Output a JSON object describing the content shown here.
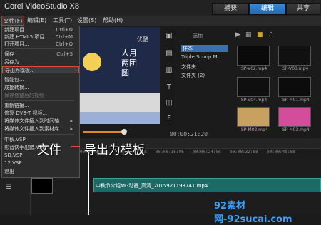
{
  "app": {
    "title": "Corel VideoStudio X8"
  },
  "mode_tabs": {
    "capture": "捕获",
    "edit": "编辑",
    "share": "共享"
  },
  "menubar": {
    "file": "文件(F)",
    "edit": "编辑(E)",
    "tools": "工具(T)",
    "settings": "设置(S)",
    "help": "帮助(H)"
  },
  "file_menu": {
    "items": [
      {
        "label": "新建项目",
        "shortcut": "Ctrl+N"
      },
      {
        "label": "新建 HTML5 项目",
        "shortcut": "Ctrl+M"
      },
      {
        "label": "打开项目...",
        "shortcut": "Ctrl+O"
      },
      {
        "label": "保存",
        "shortcut": "Ctrl+S"
      },
      {
        "label": "另存为...",
        "shortcut": ""
      },
      {
        "label": "导出为模板...",
        "shortcut": ""
      },
      {
        "label": "智能包...",
        "shortcut": ""
      },
      {
        "label": "成批转换...",
        "shortcut": ""
      },
      {
        "label": "保存修整后的视频",
        "shortcut": ""
      },
      {
        "label": "重新链接...",
        "shortcut": ""
      },
      {
        "label": "修复 DVB-T 视频...",
        "shortcut": ""
      },
      {
        "label": "将媒体文件插入到时间轴",
        "shortcut": "▸"
      },
      {
        "label": "将媒体文件插入到素材库",
        "shortcut": "▸"
      },
      {
        "label": "中秋.VSP",
        "shortcut": ""
      },
      {
        "label": "影音快手出錯.VSP",
        "shortcut": ""
      },
      {
        "label": "SD.VSP",
        "shortcut": ""
      },
      {
        "label": "12.VSP",
        "shortcut": ""
      },
      {
        "label": "退出",
        "shortcut": ""
      }
    ]
  },
  "preview": {
    "watermark": "优酷",
    "text": "人月两团圆"
  },
  "timecode": "00:00:21:20",
  "library": {
    "add_label": "添加",
    "folders": [
      "样本",
      "Triple Scoop M...",
      "文件夹",
      "文件夹 (2)"
    ],
    "thumbs": [
      "SP-V02.mp4",
      "SP-V03.mp4",
      "SP-V04.mp4",
      "SP-M01.mp4",
      "SP-M02.mp4",
      "SP-M03.mp4"
    ]
  },
  "annotation": {
    "left": "文件",
    "right": "导出为模板"
  },
  "ruler": {
    "ticks": [
      "00:00:00:00",
      "00:00:08:18",
      "00:00:16:06",
      "00:00:24:06",
      "00:00:32:08",
      "00:00:40:08"
    ]
  },
  "timeline": {
    "clip_label": "中秋节介绍MG动画_高清_2015921193741.mp4"
  },
  "site_watermark": "92素材网-92sucai.com",
  "colors": {
    "accent": "#1f67b1",
    "highlight": "#e24a3b",
    "clip": "#1a6a66",
    "moon": "#f3cf55"
  }
}
